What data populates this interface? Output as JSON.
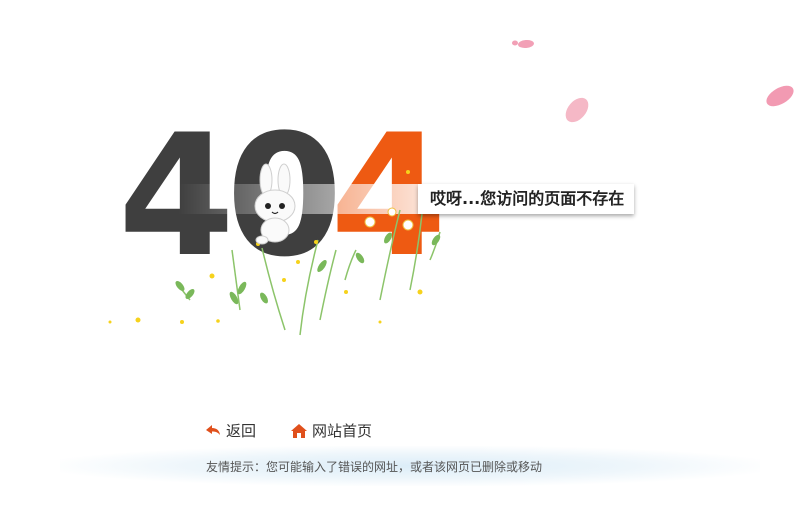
{
  "error_code": {
    "first": "4",
    "middle": "0",
    "last": "4"
  },
  "message": "哎呀...您访问的页面不存在",
  "nav": {
    "back_label": "返回",
    "home_label": "网站首页"
  },
  "hint": "友情提示：您可能输入了错误的网址，或者该网页已删除或移动",
  "colors": {
    "dark_digit": "#3f3f3f",
    "accent": "#ee5a12",
    "petal": "#f2a0b6"
  },
  "icons": [
    "back-arrow-icon",
    "home-icon"
  ]
}
